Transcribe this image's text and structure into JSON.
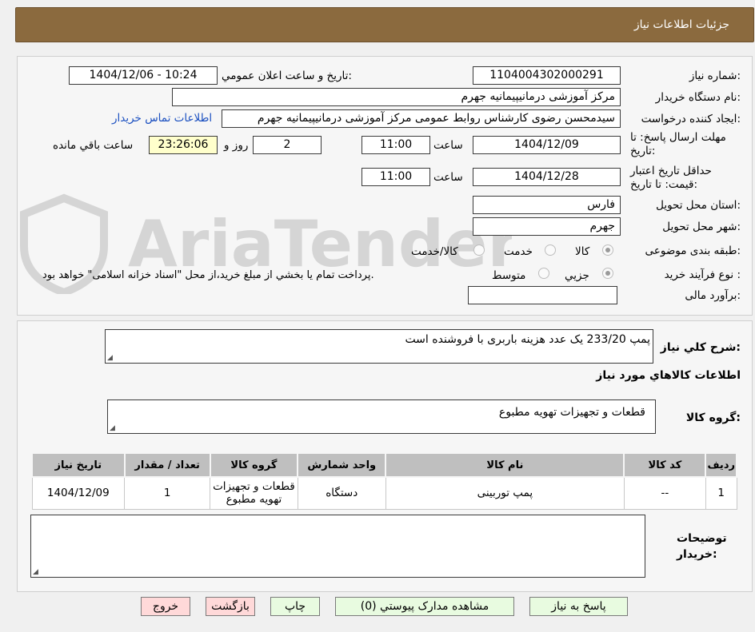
{
  "header": {
    "title": "جزئیات اطلاعات نیاز"
  },
  "watermark": {
    "text": "AriaTender.neT"
  },
  "form": {
    "need_number_label": "شماره نیاز:",
    "need_number_value": "1104004302000291",
    "announce_label": "تاریخ و ساعت اعلان عمومي:",
    "announce_value": "1404/12/06 - 10:24",
    "buyer_org_label": "نام دستگاه خريدار:",
    "buyer_org_value": "مرکز آموزشی درمانیپیمانیه جهرم",
    "requester_label": "ايجاد کننده درخواست:",
    "requester_value": "سیدمحسن رضوی کارشناس روابط عمومی مرکز آموزشی درمانیپیمانیه جهرم",
    "contact_link": "اطلاعات تماس خريدار",
    "deadline_label": "مهلت ارسال پاسخ: تا تاريخ:",
    "deadline_date": "1404/12/09",
    "time_label": "ساعت",
    "deadline_time": "11:00",
    "days_value": "2",
    "days_label": "روز و",
    "remaining_time": "23:26:06",
    "remaining_label": "ساعت باقي مانده",
    "validity_label": "حداقل تاريخ اعتبار قيمت: تا تاريخ:",
    "validity_date": "1404/12/28",
    "validity_time": "11:00",
    "province_label": "استان محل تحويل:",
    "province_value": "فارس",
    "city_label": "شهر محل تحويل:",
    "city_value": "جهرم",
    "category_label": "طبقه بندی موضوعی:",
    "category_options": [
      "کالا",
      "خدمت",
      "کالا/خدمت"
    ],
    "category_selected": "کالا",
    "process_label": "نوع فرآيند خريد :",
    "process_options": [
      "جزيي",
      "متوسط"
    ],
    "process_selected": "جزيي",
    "process_note": "پرداخت تمام يا بخشي از مبلغ خريد،از محل \"اسناد خزانه اسلامی\" خواهد بود.",
    "budget_label": "برآورد مالی:",
    "budget_value": ""
  },
  "summary": {
    "label": "شرح کلي نياز:",
    "value": "پمپ 233/20 یک عدد  هزینه باربری با فروشنده است"
  },
  "goods": {
    "section_title": "اطلاعات کالاهاي مورد نياز",
    "group_label": "گروه کالا:",
    "group_value": "قطعات و تجهیزات تهویه مطبوع"
  },
  "table": {
    "headers": [
      "رديف",
      "کد کالا",
      "نام کالا",
      "واحد شمارش",
      "گروه کالا",
      "تعداد / مقدار",
      "تاريخ نياز"
    ],
    "rows": [
      [
        "1",
        "--",
        "پمپ توربینی",
        "دستگاه",
        "قطعات و تجهیزات تهویه مطبوع",
        "1",
        "1404/12/09"
      ]
    ]
  },
  "notes": {
    "label": "توضيحات خريدار:",
    "value": ""
  },
  "buttons": {
    "reply": "پاسخ به نیاز",
    "attachments": "مشاهده مدارک پیوستي (0)",
    "print": "چاپ",
    "back": "بازگشت",
    "exit": "خروج"
  }
}
